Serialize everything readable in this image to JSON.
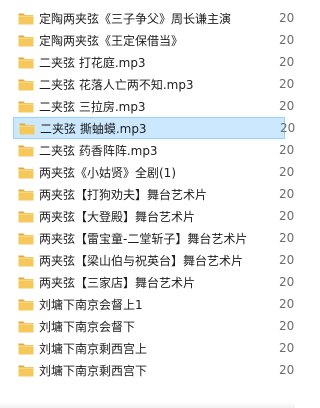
{
  "files": [
    {
      "name": "定陶两夹弦《三子争父》周长谦主演",
      "date": "20",
      "selected": false
    },
    {
      "name": "定陶两夹弦《王定保借当》",
      "date": "20",
      "selected": false
    },
    {
      "name": "二夹弦 打花庭.mp3",
      "date": "20",
      "selected": false
    },
    {
      "name": "二夹弦 花落人亡两不知.mp3",
      "date": "20",
      "selected": false
    },
    {
      "name": "二夹弦 三拉房.mp3",
      "date": "20",
      "selected": false
    },
    {
      "name": "二夹弦 撕蚰蟆.mp3",
      "date": "20",
      "selected": true
    },
    {
      "name": "二夹弦 药香阵阵.mp3",
      "date": "20",
      "selected": false
    },
    {
      "name": "两夹弦《小姑贤》全剧(1)",
      "date": "20",
      "selected": false
    },
    {
      "name": "两夹弦【打狗劝夫】舞台艺术片",
      "date": "20",
      "selected": false
    },
    {
      "name": "两夹弦【大登殿】舞台艺术片",
      "date": "20",
      "selected": false
    },
    {
      "name": "两夹弦【雷宝童-二堂斩子】舞台艺术片",
      "date": "20",
      "selected": false
    },
    {
      "name": "两夹弦【梁山伯与祝英台】舞台艺术片",
      "date": "20",
      "selected": false
    },
    {
      "name": "两夹弦【三家店】舞台艺术片",
      "date": "20",
      "selected": false
    },
    {
      "name": "刘墉下南京会督上1",
      "date": "20",
      "selected": false
    },
    {
      "name": "刘墉下南京会督下",
      "date": "20",
      "selected": false
    },
    {
      "name": "刘墉下南京剩西宫上",
      "date": "20",
      "selected": false
    },
    {
      "name": "刘墉下南京剩西宫下",
      "date": "20",
      "selected": false
    }
  ],
  "icon": "folder-icon",
  "colors": {
    "folder": "#f6c85a",
    "folder_dark": "#e3a93a",
    "selection": "#cce8ff",
    "selection_border": "#99d1ff"
  }
}
